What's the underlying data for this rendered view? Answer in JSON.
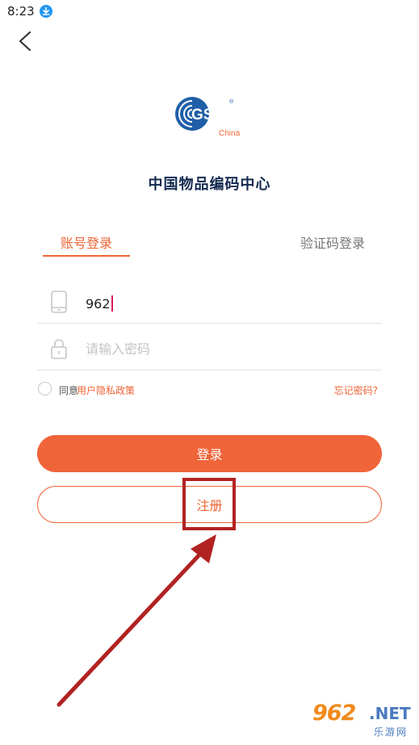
{
  "status_bar": {
    "time": "8:23",
    "download_icon": "download-icon"
  },
  "logo": {
    "mark": "GS1",
    "registered": "®",
    "region": "China"
  },
  "org_title": "中国物品编码中心",
  "tabs": [
    {
      "label": "账号登录",
      "active": true
    },
    {
      "label": "验证码登录",
      "active": false
    }
  ],
  "phone_field": {
    "value": "962",
    "icon": "phone-icon"
  },
  "password_field": {
    "placeholder": "请输入密码",
    "icon": "lock-icon"
  },
  "agreement": {
    "prefix": "同意",
    "link": "用户隐私政策"
  },
  "forgot_password": "忘记密码?",
  "buttons": {
    "login": "登录",
    "register": "注册"
  },
  "watermark": {
    "main": "962",
    "net": ".NET",
    "sub": "乐游网"
  },
  "colors": {
    "accent": "#f0643a",
    "title": "#13294f",
    "annotation": "#b22222",
    "logo_blue": "#1f5fa8"
  }
}
